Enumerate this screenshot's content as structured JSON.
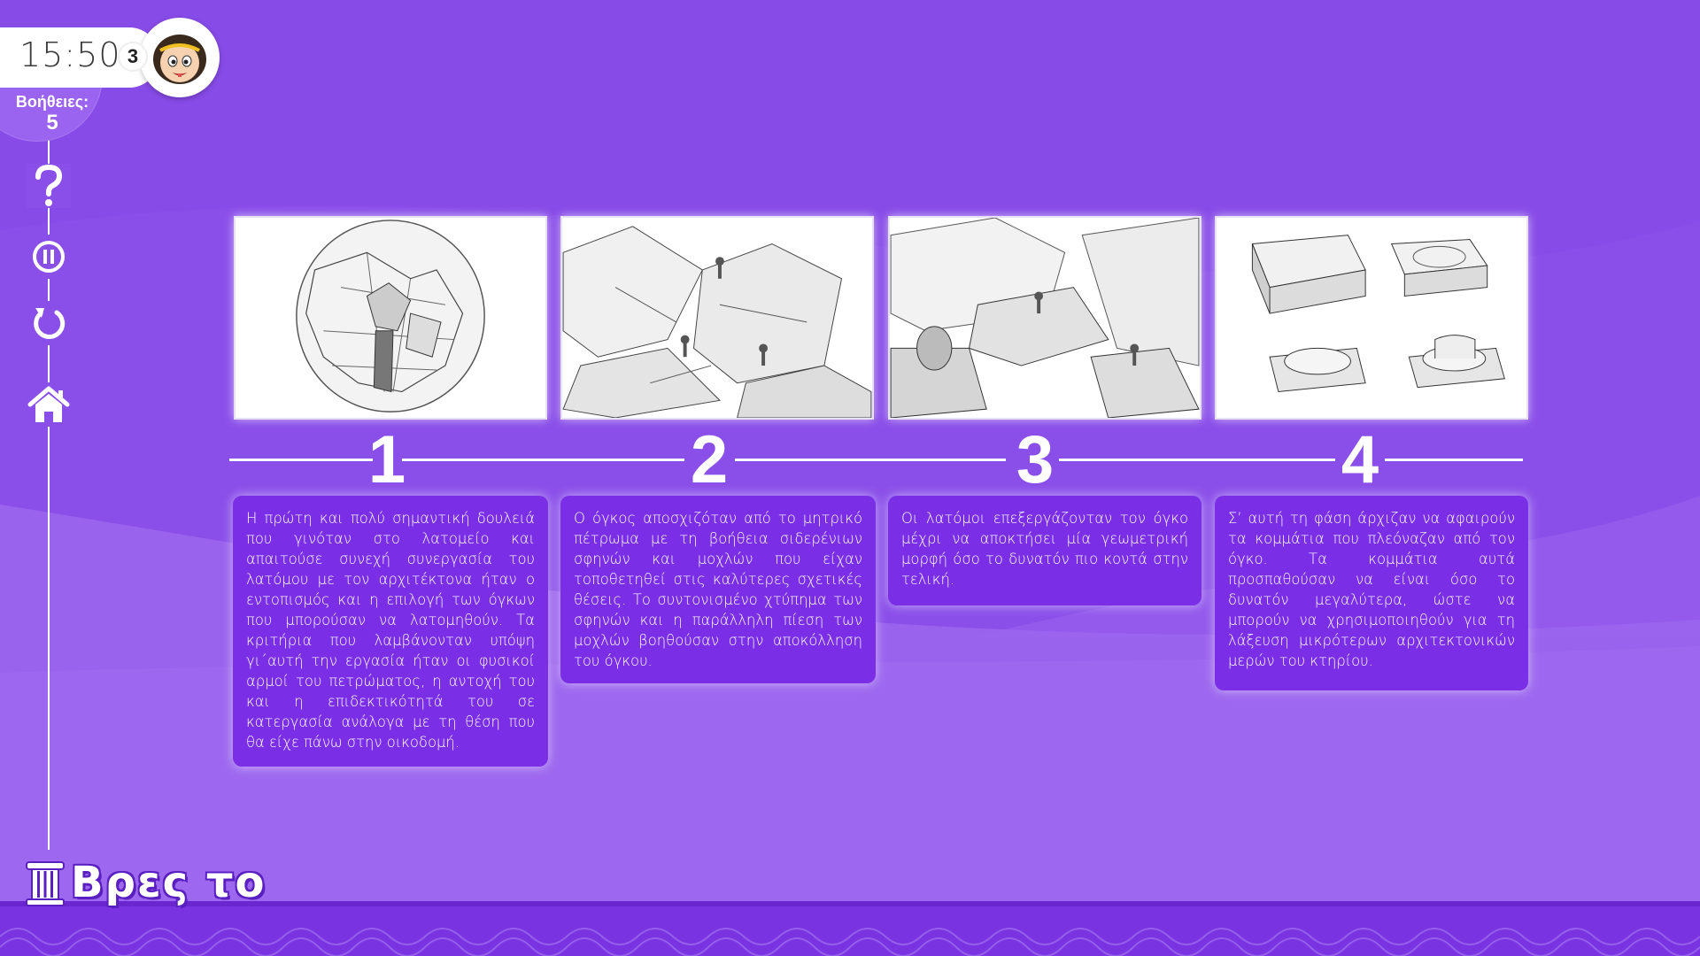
{
  "timer": {
    "value": "15:50"
  },
  "helps": {
    "label": "Βοήθειες:",
    "count": "5"
  },
  "player": {
    "badge": "3",
    "avatar_icon": "girl-avatar-icon"
  },
  "sidebar": {
    "items": [
      {
        "name": "help",
        "icon": "question-icon"
      },
      {
        "name": "pause",
        "icon": "pause-icon"
      },
      {
        "name": "restart",
        "icon": "restart-icon"
      },
      {
        "name": "home",
        "icon": "home-icon"
      }
    ]
  },
  "steps": [
    {
      "number": "1",
      "image": "quarry-circle-sketch",
      "text": "Η πρώτη και πολύ σημαντική δουλειά που γινόταν στο λατομείο και απαιτούσε συνεχή συνεργασία του λατόμου με τον αρχιτέκτονα ήταν ο εντοπισμός και η επιλογή των όγκων που μπορούσαν να λατομηθούν. Τα κριτήρια που λαμβάνονταν υπόψη γι΄αυτή την εργασία ήταν οι φυσικοί αρμοί του πετρώματος, η αντοχή του και η επιδεκτικότητά του σε κατεργασία ανάλογα με τη θέση που θα είχε πάνω στην οικοδομή."
    },
    {
      "number": "2",
      "image": "workers-splitting-rock-sketch",
      "text": "Ο όγκος αποσχιζόταν από το μητρικό πέτρωμα με τη βοήθεια σιδερένιων σφηνών και μοχλών που είχαν τοποθετηθεί στις καλύτερες σχετικές θέσεις. Το συντονισμένο χτύπημα των σφηνών και η παράλληλη πίεση των μοχλών βοηθούσαν στην αποκόλληση του όγκου."
    },
    {
      "number": "3",
      "image": "workers-shaping-block-sketch",
      "text": "Οι λατόμοι επεξεργάζονταν τον όγκο μέχρι να αποκτήσει μία γεωμετρική μορφή όσο το δυνατόν πιο κοντά στην τελική."
    },
    {
      "number": "4",
      "image": "architectural-blocks-sketch",
      "text": "Σ’ αυτή τη φάση άρχιζαν να αφαιρούν τα κομμάτια που πλεόναζαν από τον όγκο. Τα κομμάτια αυτά προσπαθούσαν να είναι όσο το δυνατόν μεγαλύτερα, ώστε να μπορούν να χρησιμοποιηθούν για τη λάξευση μικρότερων αρχιτεκτονικών μερών του κτηρίου."
    }
  ],
  "logo": {
    "text": "Βρες το",
    "icon": "column-icon"
  },
  "colors": {
    "background": "#8a4fe9",
    "card": "#7a2ee6",
    "accent": "#ffffff"
  }
}
